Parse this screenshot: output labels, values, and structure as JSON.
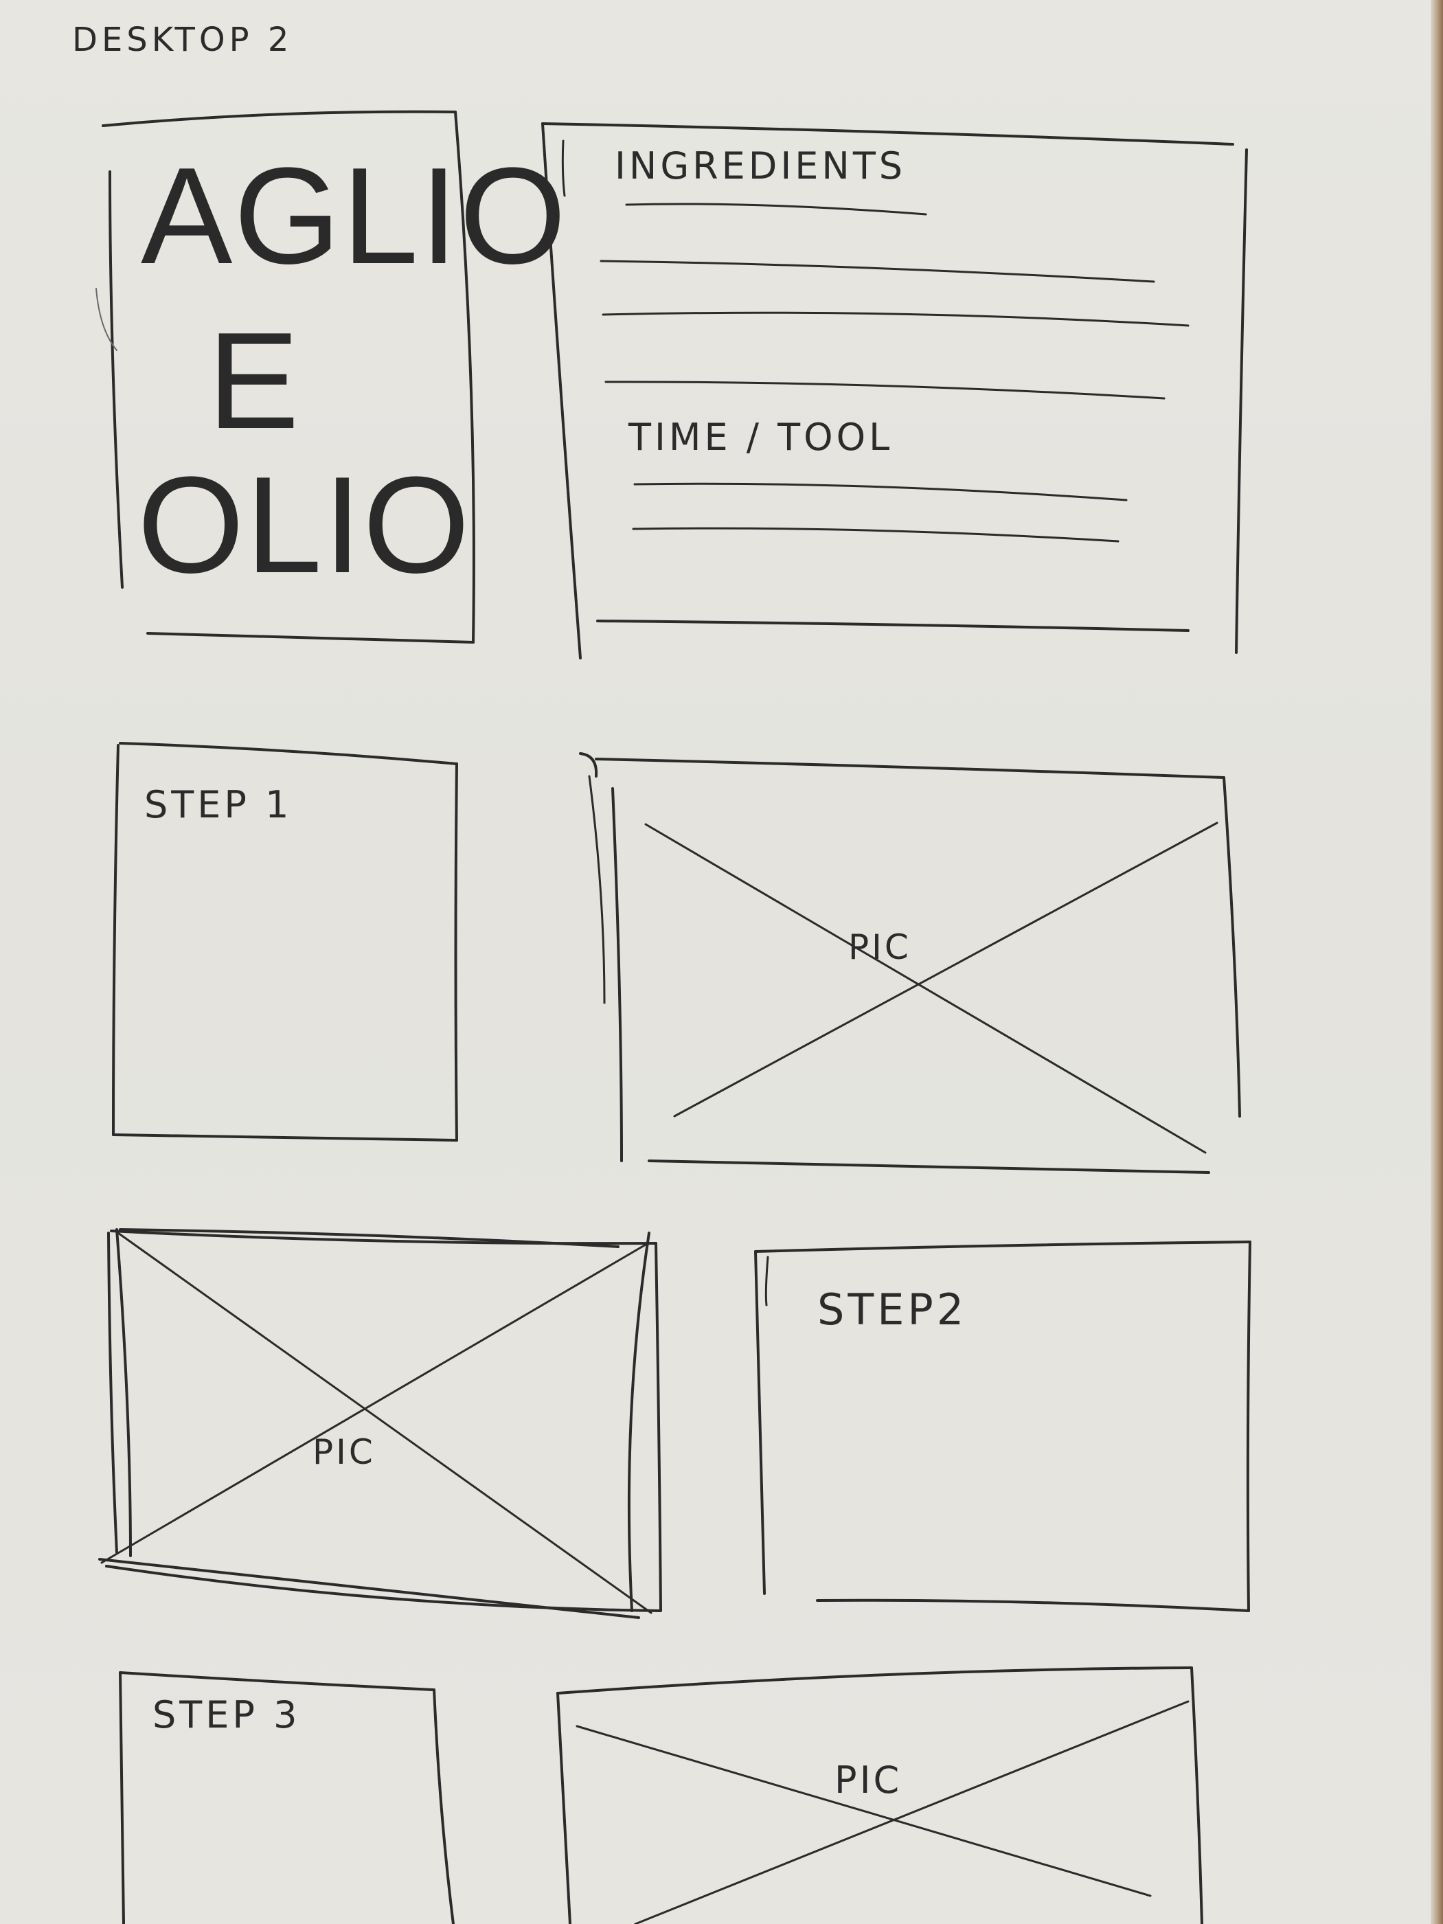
{
  "page_label": "DESKTOP 2",
  "hero": {
    "title_lines": [
      "AGLIO",
      "E",
      "OLIO"
    ]
  },
  "info": {
    "ingredients_heading": "INGREDIENTS",
    "time_tool_heading": "TIME / TOOL"
  },
  "steps": [
    {
      "label": "STEP 1",
      "image_label": "PIC"
    },
    {
      "label": "STEP2",
      "image_label": "PIC"
    },
    {
      "label": "STEP 3",
      "image_label": "PIC"
    }
  ],
  "colors": {
    "paper": "#e6e4df",
    "ink": "#2b2b2b"
  }
}
